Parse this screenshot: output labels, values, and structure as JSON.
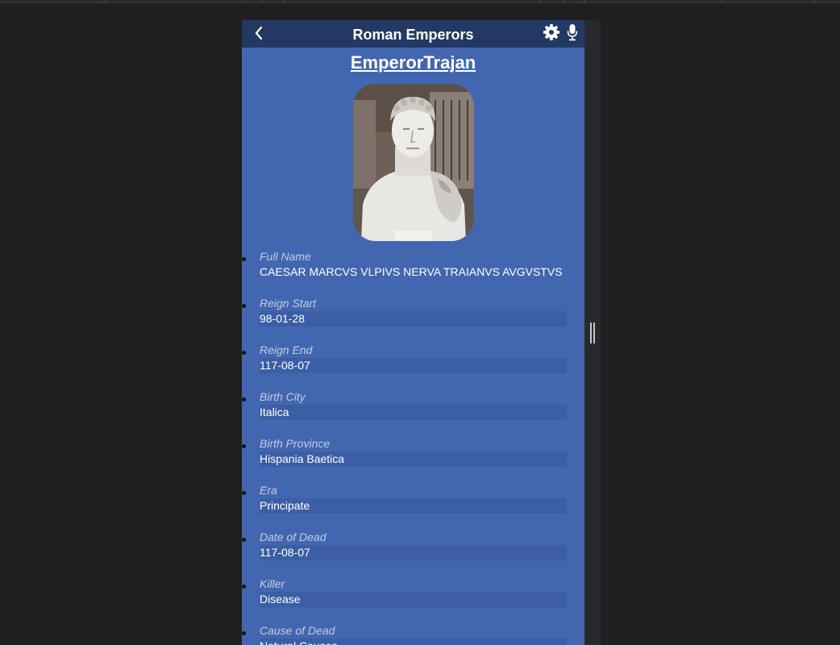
{
  "header": {
    "title": "Roman Emperors",
    "back_icon": "chevron-left-icon",
    "settings_icon": "gear-icon",
    "mic_icon": "microphone-icon"
  },
  "emperor": {
    "name": "EmperorTrajan",
    "portrait": "marble bust portrait"
  },
  "fields": [
    {
      "label": "Full Name",
      "value": "CAESAR MARCVS VLPIVS NERVA TRAIANVS AVGVSTVS"
    },
    {
      "label": "Reign Start",
      "value": "98-01-28"
    },
    {
      "label": "Reign End",
      "value": "117-08-07"
    },
    {
      "label": "Birth City",
      "value": "Italica"
    },
    {
      "label": "Birth Province",
      "value": "Hispania Baetica"
    },
    {
      "label": "Era",
      "value": "Principate"
    },
    {
      "label": "Date of Dead",
      "value": "117-08-07"
    },
    {
      "label": "Killer",
      "value": "Disease"
    },
    {
      "label": "Cause of Dead",
      "value": "Natural Causes"
    }
  ],
  "colors": {
    "page_bg": "#1f1f22",
    "header_bg": "#233964",
    "app_bg": "#4267b0",
    "value_bg": "#3b5ea4"
  }
}
